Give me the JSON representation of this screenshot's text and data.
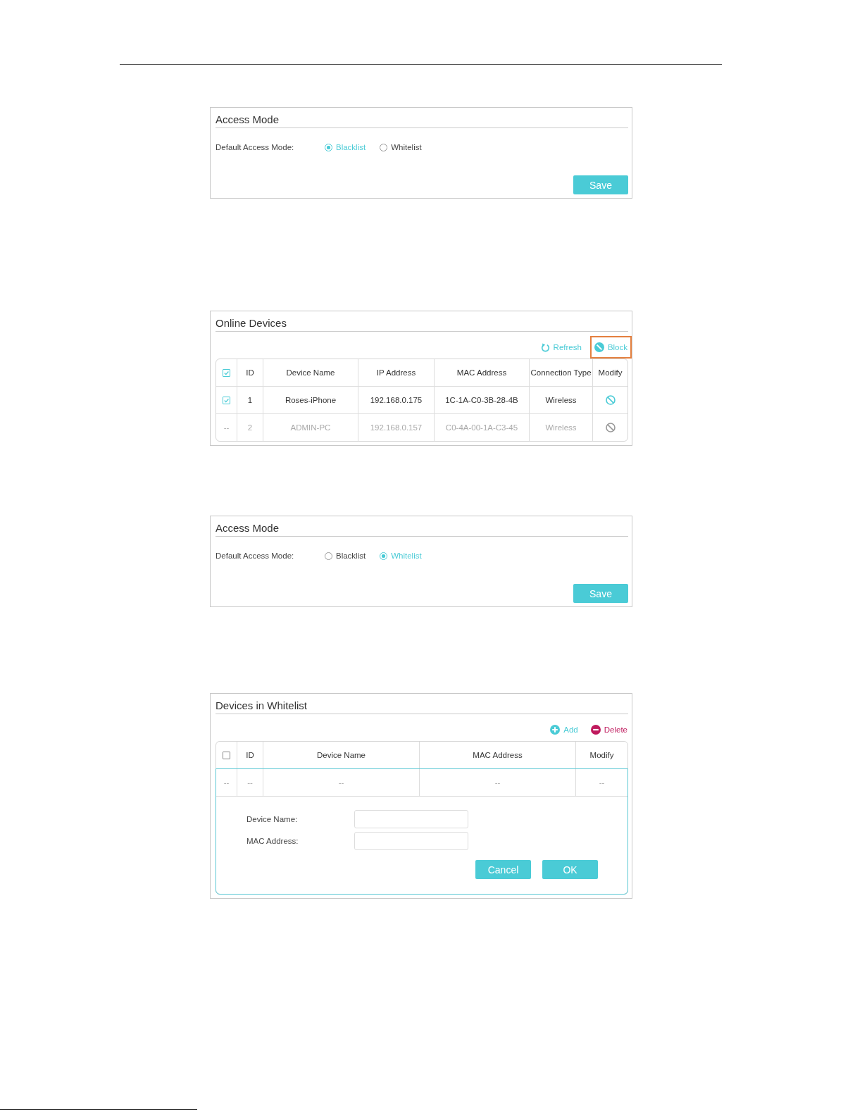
{
  "panels": [
    {
      "kind": "access_mode",
      "title": "Access Mode",
      "field_label": "Default Access Mode:",
      "options": [
        {
          "label": "Blacklist",
          "selected": true
        },
        {
          "label": "Whitelist",
          "selected": false
        }
      ],
      "button": "Save"
    },
    {
      "kind": "device_table",
      "title": "Online Devices",
      "actions": [
        {
          "kind": "refresh",
          "label": "Refresh",
          "highlighted": false
        },
        {
          "kind": "block",
          "label": "Block",
          "highlighted": true
        }
      ],
      "table": {
        "select_all_checked": true,
        "columns": [
          "ID",
          "Device Name",
          "IP Address",
          "MAC Address",
          "Connection Type",
          "Modify"
        ],
        "rows": [
          {
            "disabled": false,
            "select": {
              "kind": "checkbox",
              "checked": true
            },
            "cells": [
              "1",
              "Roses-iPhone",
              "192.168.0.175",
              "1C-1A-C0-3B-28-4B",
              "Wireless"
            ],
            "modify": {
              "kind": "icon"
            }
          },
          {
            "disabled": true,
            "select": {
              "kind": "text",
              "text": "--"
            },
            "cells": [
              "2",
              "ADMIN-PC",
              "192.168.0.157",
              "C0-4A-00-1A-C3-45",
              "Wireless"
            ],
            "modify": {
              "kind": "icon"
            }
          }
        ]
      }
    },
    {
      "kind": "access_mode",
      "title": "Access Mode",
      "field_label": "Default Access Mode:",
      "options": [
        {
          "label": "Blacklist",
          "selected": false
        },
        {
          "label": "Whitelist",
          "selected": true
        }
      ],
      "button": "Save"
    },
    {
      "kind": "device_table",
      "title": "Devices in Whitelist",
      "actions": [
        {
          "kind": "add",
          "label": "Add"
        },
        {
          "kind": "delete",
          "label": "Delete"
        }
      ],
      "table": {
        "select_all_checked": false,
        "columns": [
          "ID",
          "Device Name",
          "MAC Address",
          "Modify"
        ],
        "rows": [
          {
            "disabled": true,
            "select": {
              "kind": "text",
              "text": "--"
            },
            "cells": [
              "--",
              "--",
              "--"
            ],
            "modify": {
              "kind": "text",
              "text": "--"
            }
          }
        ],
        "editor": {
          "fields": [
            {
              "label": "Device Name:"
            },
            {
              "label": "MAC Address:"
            }
          ],
          "buttons": [
            "Cancel",
            "OK"
          ]
        }
      }
    }
  ]
}
